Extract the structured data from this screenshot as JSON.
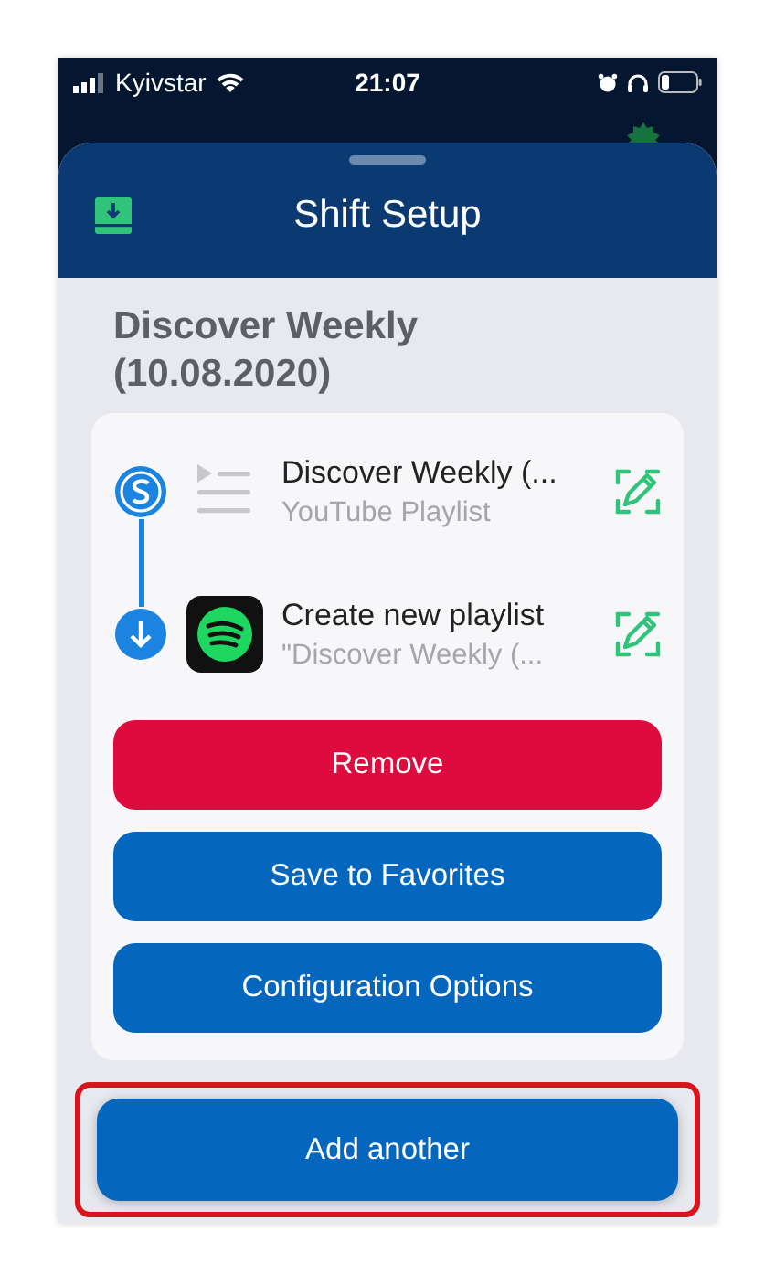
{
  "status_bar": {
    "carrier": "Kyivstar",
    "time": "21:07"
  },
  "sheet": {
    "title": "Shift Setup",
    "shift_name": "Discover Weekly (10.08.2020)",
    "steps": [
      {
        "kind": "source",
        "title": "Discover Weekly (...",
        "subtitle": "YouTube Playlist"
      },
      {
        "kind": "destination",
        "title": "Create new playlist",
        "subtitle": "\"Discover Weekly (..."
      }
    ],
    "buttons": [
      {
        "label": "Remove",
        "kind": "danger"
      },
      {
        "label": "Save to Favorites",
        "kind": "primary"
      },
      {
        "label": "Configuration Options",
        "kind": "primary"
      }
    ],
    "footer_button": {
      "label": "Add another",
      "highlighted": true
    }
  }
}
